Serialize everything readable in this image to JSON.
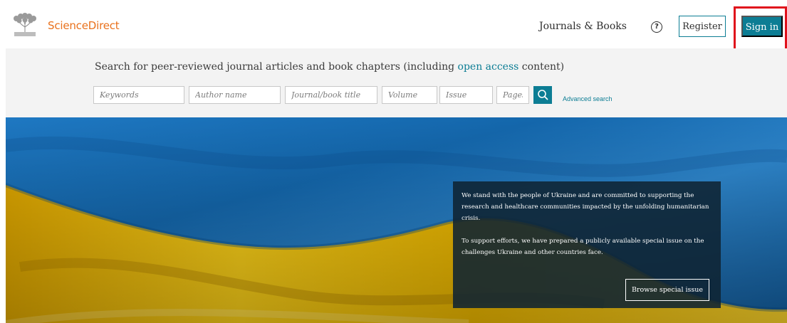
{
  "header": {
    "brand": "ScienceDirect",
    "journals_label": "Journals & Books",
    "help_symbol": "?",
    "register_label": "Register",
    "signin_label": "Sign in"
  },
  "search": {
    "intro_before": "Search for peer-reviewed journal articles and book chapters (including ",
    "intro_link": "open access",
    "intro_after": " content)",
    "keywords_placeholder": "Keywords",
    "author_placeholder": "Author name",
    "journal_placeholder": "Journal/book title",
    "volume_placeholder": "Volume",
    "issue_placeholder": "Issue",
    "pages_placeholder": "Pages",
    "advanced_label": "Advanced search"
  },
  "hero": {
    "notice_p1": "We stand with the people of Ukraine and are committed to supporting the research and healthcare communities impacted by the unfolding humanitarian crisis.",
    "notice_p2": "To support efforts, we have prepared a publicly available special issue on the challenges Ukraine and other countries face.",
    "browse_label": "Browse special issue"
  },
  "colors": {
    "brand_orange": "#e9711c",
    "accent_teal": "#0c7d94",
    "flag_blue": "#1d6fb8",
    "flag_yellow": "#f4c600",
    "highlight_red": "#e0121c"
  },
  "icons": {
    "logo": "elsevier-tree-logo",
    "help": "question-circle-icon",
    "search": "magnifier-icon"
  }
}
